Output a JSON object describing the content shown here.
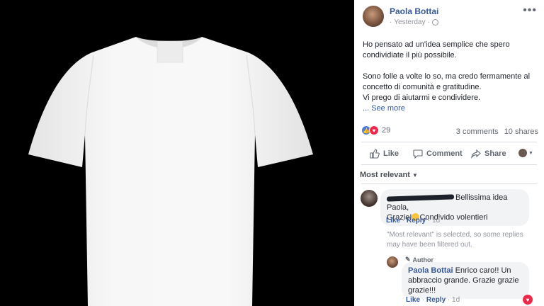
{
  "post": {
    "author": "Paola Bottai",
    "time": "Yesterday",
    "paragraph1": "Ho pensato ad un'idea semplice che spero condividiate il più possibile.",
    "paragraph2_l1": "Sono folle a volte lo so, ma credo fermamente al concetto di comunità e gratitudine.",
    "paragraph2_l2": "Vi prego di aiutarmi e condividere.",
    "see_more": "... See more",
    "reaction_count": "29",
    "comments_count": "3 comments",
    "shares_count": "10 shares"
  },
  "actions": {
    "like": "Like",
    "comment": "Comment",
    "share": "Share"
  },
  "sort": {
    "label": "Most relevant"
  },
  "comment1": {
    "name_fragment": "Bellissima idea Paola,",
    "text": "Grazie!",
    "text2": "Condivido volentieri",
    "like": "Like",
    "reply": "Reply",
    "time": "1d"
  },
  "filter_note": "\"Most relevant\" is selected, so some replies may have been filtered out.",
  "reply1": {
    "badge": "Author",
    "name": "Paola Bottai",
    "text": "Enrico caro!! Un abbraccio grande. Grazie grazie grazie!!!",
    "like": "Like",
    "reply": "Reply",
    "time": "1d"
  },
  "colors": {
    "link": "#365899",
    "like_blue": "#4c7bd9",
    "love_red": "#f0284a"
  }
}
